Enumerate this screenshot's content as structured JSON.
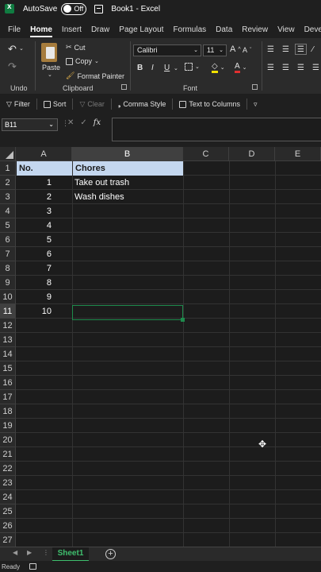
{
  "titlebar": {
    "autosave_label": "AutoSave",
    "toggle_state": "Off",
    "doc_title": "Book1  -  Excel"
  },
  "menu": [
    "File",
    "Home",
    "Insert",
    "Draw",
    "Page Layout",
    "Formulas",
    "Data",
    "Review",
    "View",
    "Devel"
  ],
  "ribbon": {
    "clipboard": {
      "paste": "Paste",
      "cut": "Cut",
      "copy": "Copy",
      "format_painter": "Format Painter",
      "label": "Clipboard"
    },
    "undo_label": "Undo",
    "font": {
      "name": "Calibri",
      "size": "11",
      "bold": "B",
      "italic": "I",
      "underline": "U",
      "grow": "A",
      "shrink": "A",
      "color_a": "A",
      "label": "Font"
    }
  },
  "quick_toolbar": {
    "filter": "Filter",
    "sort": "Sort",
    "clear": "Clear",
    "comma_style": "Comma Style",
    "text_to_columns": "Text to Columns"
  },
  "formula_bar": {
    "name_box": "B11",
    "fx": "fx",
    "formula": ""
  },
  "grid": {
    "columns": [
      "A",
      "B",
      "C",
      "D",
      "E"
    ],
    "selected_column": "B",
    "selected_row": "11",
    "rows": [
      "1",
      "2",
      "3",
      "4",
      "5",
      "6",
      "7",
      "8",
      "9",
      "10",
      "11",
      "12",
      "13",
      "14",
      "15",
      "16",
      "17",
      "18",
      "19",
      "20",
      "21",
      "22",
      "23",
      "24",
      "25",
      "26",
      "27"
    ],
    "header": {
      "a": "No.",
      "b": "Chores"
    },
    "col_a_values": [
      "1",
      "2",
      "3",
      "4",
      "5",
      "6",
      "7",
      "8",
      "9",
      "10"
    ],
    "col_b_values": [
      "Take out trash",
      "Wash dishes"
    ]
  },
  "sheets": {
    "active": "Sheet1",
    "add": "+"
  },
  "status": {
    "ready": "Ready"
  }
}
